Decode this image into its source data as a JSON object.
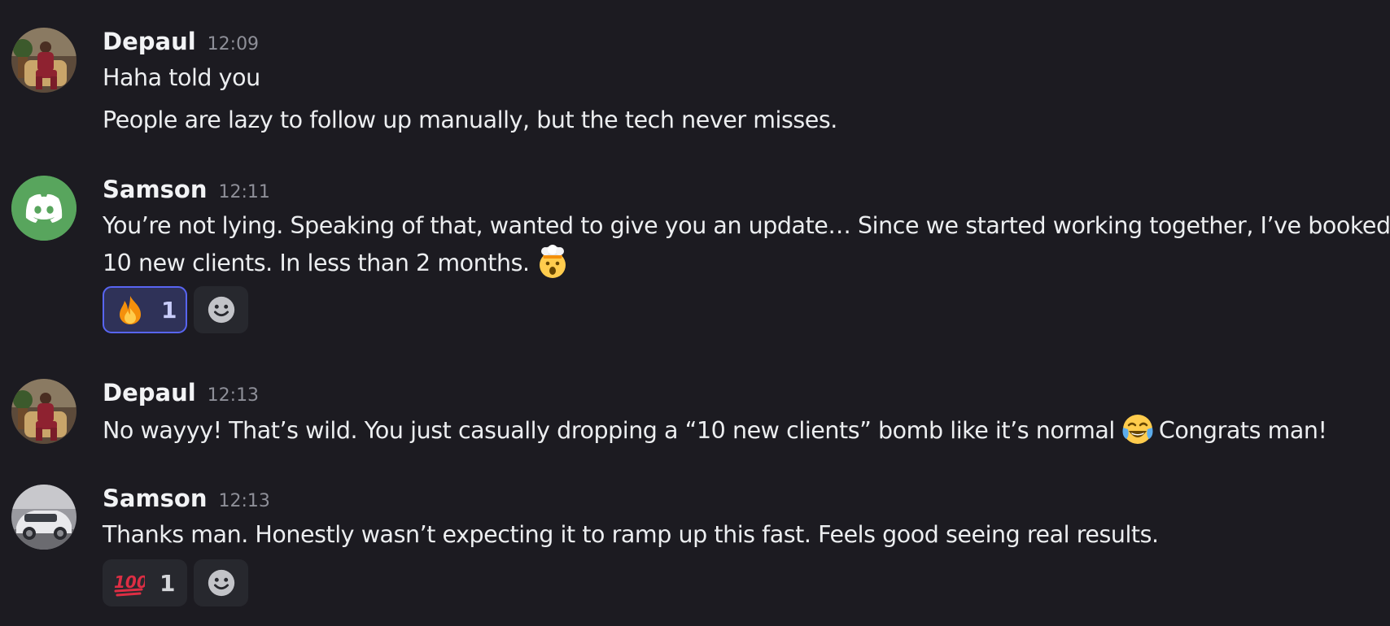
{
  "messages": [
    {
      "author": "Depaul",
      "time": "12:09",
      "avatar_icon": "person-photo-avatar",
      "lines": [
        "Haha told you",
        "People are lazy to follow up manually, but the tech never misses."
      ]
    },
    {
      "author": "Samson",
      "time": "12:11",
      "avatar_icon": "discord-default-avatar",
      "lines": [
        "You’re not lying. Speaking of that, wanted to give you an update… Since we started working together, I’ve booked",
        "10 new clients. In less than 2 months."
      ],
      "inline_emoji": "exploding-head-emoji",
      "reactions": [
        {
          "emoji": "fire-emoji",
          "count": "1",
          "active": true
        }
      ]
    },
    {
      "author": "Depaul",
      "time": "12:13",
      "avatar_icon": "person-photo-avatar",
      "line_before_emoji": "No wayyy! That’s wild. You just casually dropping a “10 new clients” bomb like it’s normal",
      "inline_emoji": "tears-of-joy-emoji",
      "line_after_emoji": "Congrats man!"
    },
    {
      "author": "Samson",
      "time": "12:13",
      "avatar_icon": "car-photo-avatar",
      "lines": [
        "Thanks man. Honestly wasn’t expecting it to ramp up this fast. Feels good seeing real results."
      ],
      "reactions": [
        {
          "emoji": "hundred-points-emoji",
          "count": "1",
          "active": false
        }
      ]
    }
  ],
  "colors": {
    "background": "#1c1b21",
    "discord_avatar": "#58a55d",
    "reaction_active_border": "#5865f2",
    "timestamp": "#8e8f98"
  }
}
